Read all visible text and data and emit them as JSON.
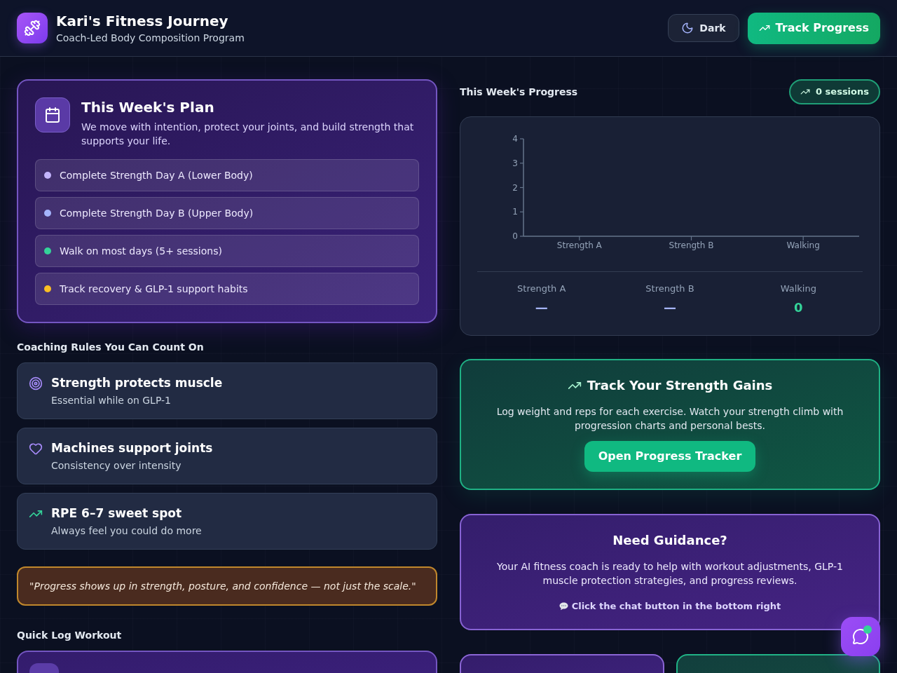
{
  "header": {
    "title": "Kari's Fitness Journey",
    "subtitle": "Coach-Led Body Composition Program",
    "buttons": [
      {
        "label": "Dark",
        "kind": "theme"
      },
      {
        "label": "Track Progress",
        "kind": "primary"
      }
    ]
  },
  "plan": {
    "title": "This Week's Plan",
    "description": "We move with intention, protect your joints, and build strength that supports your life.",
    "items": [
      {
        "text": "Complete Strength Day A (Lower Body)",
        "color": "#c4b5fd"
      },
      {
        "text": "Complete Strength Day B (Upper Body)",
        "color": "#a5b4fc"
      },
      {
        "text": "Walk on most days (5+ sessions)",
        "color": "#34d399"
      },
      {
        "text": "Track recovery & GLP-1 support habits",
        "color": "#fbbf24"
      }
    ]
  },
  "rules": {
    "heading": "Coaching Rules You Can Count On",
    "items": [
      {
        "kind": "target",
        "title": "Strength protects muscle",
        "subtitle": "Essential while on GLP-1"
      },
      {
        "kind": "heart",
        "title": "Machines support joints",
        "subtitle": "Consistency over intensity"
      },
      {
        "kind": "trend",
        "title": "RPE 6–7 sweet spot",
        "subtitle": "Always feel you could do more"
      }
    ]
  },
  "quote": "\"Progress shows up in strength, posture, and confidence — not just the scale.\"",
  "quick_log": {
    "heading": "Quick Log Workout",
    "cards": [
      {
        "kind": "workout"
      }
    ]
  },
  "progress": {
    "heading": "This Week's Progress",
    "badge": "0 sessions",
    "chart_data": [
      {
        "type": "bar",
        "categories": [
          "Strength A",
          "Strength B",
          "Walking"
        ],
        "values": [
          0,
          0,
          0
        ],
        "ylim": [
          0,
          4
        ],
        "yticks": [
          0,
          1,
          2,
          3,
          4
        ]
      }
    ],
    "stats": [
      {
        "label": "Strength A",
        "value": "—",
        "color": "#a5b4fc"
      },
      {
        "label": "Strength B",
        "value": "—",
        "color": "#a5b4fc"
      },
      {
        "label": "Walking",
        "value": "0",
        "color": "#34d399"
      }
    ]
  },
  "tracker": {
    "title": "Track Your Strength Gains",
    "description": "Log weight and reps for each exercise. Watch your strength climb with progression charts and personal bests.",
    "button": "Open Progress Tracker"
  },
  "guidance": {
    "title": "Need Guidance?",
    "description": "Your AI fitness coach is ready to help with workout adjustments, GLP-1 muscle protection strategies, and progress reviews.",
    "hint": "Click the chat button in the bottom right"
  },
  "summary_cards": [
    {
      "kind": "primary"
    },
    {
      "kind": "success"
    }
  ],
  "chat_button": {
    "online": true
  }
}
